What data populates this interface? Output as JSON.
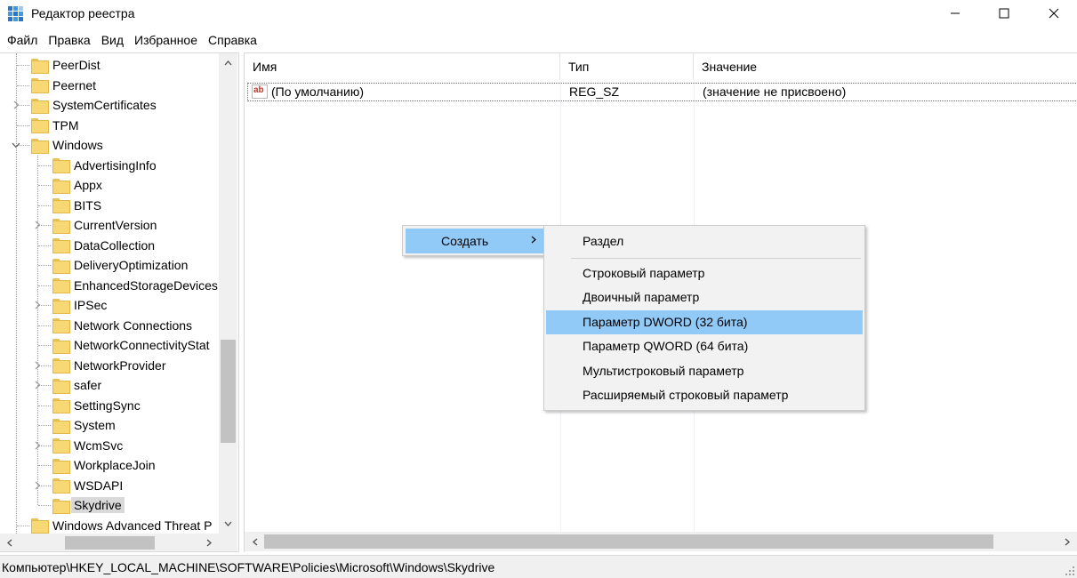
{
  "window": {
    "title": "Редактор реестра"
  },
  "menu": {
    "items": [
      "Файл",
      "Правка",
      "Вид",
      "Избранное",
      "Справка"
    ]
  },
  "tree": {
    "items": [
      {
        "label": "PeerDist",
        "level": 1,
        "expandable": false
      },
      {
        "label": "Peernet",
        "level": 1,
        "expandable": false
      },
      {
        "label": "SystemCertificates",
        "level": 1,
        "expandable": true
      },
      {
        "label": "TPM",
        "level": 1,
        "expandable": false
      },
      {
        "label": "Windows",
        "level": 1,
        "expandable": true,
        "expanded": true
      },
      {
        "label": "AdvertisingInfo",
        "level": 2,
        "expandable": false
      },
      {
        "label": "Appx",
        "level": 2,
        "expandable": false
      },
      {
        "label": "BITS",
        "level": 2,
        "expandable": false
      },
      {
        "label": "CurrentVersion",
        "level": 2,
        "expandable": true
      },
      {
        "label": "DataCollection",
        "level": 2,
        "expandable": false
      },
      {
        "label": "DeliveryOptimization",
        "level": 2,
        "expandable": false
      },
      {
        "label": "EnhancedStorageDevices",
        "level": 2,
        "expandable": false
      },
      {
        "label": "IPSec",
        "level": 2,
        "expandable": true
      },
      {
        "label": "Network Connections",
        "level": 2,
        "expandable": false
      },
      {
        "label": "NetworkConnectivityStat",
        "level": 2,
        "expandable": false
      },
      {
        "label": "NetworkProvider",
        "level": 2,
        "expandable": true
      },
      {
        "label": "safer",
        "level": 2,
        "expandable": true
      },
      {
        "label": "SettingSync",
        "level": 2,
        "expandable": false
      },
      {
        "label": "System",
        "level": 2,
        "expandable": false
      },
      {
        "label": "WcmSvc",
        "level": 2,
        "expandable": true
      },
      {
        "label": "WorkplaceJoin",
        "level": 2,
        "expandable": false
      },
      {
        "label": "WSDAPI",
        "level": 2,
        "expandable": true
      },
      {
        "label": "Skydrive",
        "level": 2,
        "expandable": false,
        "selected": true
      },
      {
        "label": "Windows Advanced Threat P",
        "level": 1,
        "expandable": false
      }
    ]
  },
  "list": {
    "columns": [
      "Имя",
      "Тип",
      "Значение"
    ],
    "rows": [
      {
        "name": "(По умолчанию)",
        "type": "REG_SZ",
        "value": "(значение не присвоено)"
      }
    ]
  },
  "context_menu": {
    "create_label": "Создать",
    "submenu": [
      "Раздел",
      "Строковый параметр",
      "Двоичный параметр",
      "Параметр DWORD (32 бита)",
      "Параметр QWORD (64 бита)",
      "Мультистроковый параметр",
      "Расширяемый строковый параметр"
    ],
    "highlighted_index": 3
  },
  "status": {
    "path": "Компьютер\\HKEY_LOCAL_MACHINE\\SOFTWARE\\Policies\\Microsoft\\Windows\\Skydrive"
  },
  "colors": {
    "highlight": "#91c9f7",
    "menu_bg": "#f2f2f2",
    "folder": "#f8d775",
    "selected_tree": "#d9d9d9"
  },
  "icons": {
    "app": "registry-editor-icon",
    "value": "ab-string-value-icon",
    "folder": "folder-icon"
  }
}
